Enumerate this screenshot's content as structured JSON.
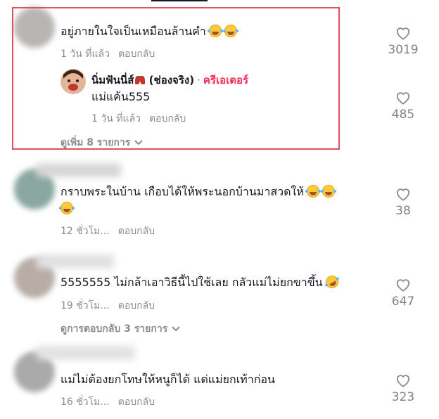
{
  "comments": [
    {
      "text": "อยู่ภายในใจเป็นเหมือนล้านคำ",
      "time": "1 วัน ที่แล้ว",
      "reply_label": "ตอบกลับ",
      "likes": "3019",
      "view_more": "ดูเพิ่ม 8 รายการ",
      "reply": {
        "username": "นิ่มฟันนี่ส์",
        "handle_note": "(ช่องจริง)",
        "separator": "·",
        "badge": "ครีเอเตอร์",
        "text": "แม่แค้น555",
        "time": "1 วัน ที่แล้ว",
        "reply_label": "ตอบกลับ",
        "likes": "485"
      }
    },
    {
      "text": "กราบพระในบ้าน เกือบได้ให้พระนอกบ้านมาสวดให้",
      "time": "12 ชั่วโม...",
      "reply_label": "ตอบกลับ",
      "likes": "38"
    },
    {
      "text": "5555555 ไม่กล้าเอาวิธีนี้ไปใช้เลย กลัวแม่ไม่ยกขาขึ้น",
      "time": "19 ชั่วโม...",
      "reply_label": "ตอบกลับ",
      "likes": "647",
      "view_replies": "ดูการตอบกลับ 3 รายการ"
    },
    {
      "text": "แม่ไม่ต้องยกโทษให้หนูก็ได้ แต่แม่ยกเท้าก่อน",
      "time": "16 ชั่วโม...",
      "reply_label": "ตอบกลับ",
      "likes": "323"
    }
  ],
  "colors": {
    "highlight": "#e05260",
    "creator": "#fe2c55",
    "muted": "#8a8b91"
  },
  "icons": {
    "like": "heart-outline-icon",
    "expand": "chevron-down-icon",
    "emoji_laugh": "tears-of-joy-emoji",
    "emoji_rofl": "rofl-emoji"
  }
}
